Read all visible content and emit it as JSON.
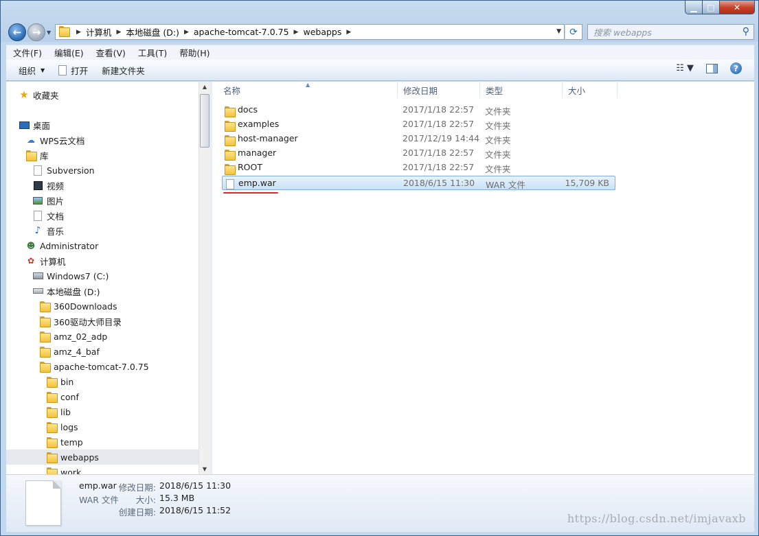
{
  "window": {
    "controls": {
      "minimize": "▁",
      "maximize": "□",
      "close": "✕"
    }
  },
  "address": {
    "crumbs": [
      "计算机",
      "本地磁盘 (D:)",
      "apache-tomcat-7.0.75",
      "webapps"
    ]
  },
  "search": {
    "placeholder": "搜索 webapps"
  },
  "menu": [
    "文件(F)",
    "编辑(E)",
    "查看(V)",
    "工具(T)",
    "帮助(H)"
  ],
  "toolbar": {
    "organize": "组织",
    "open": "打开",
    "new_folder": "新建文件夹"
  },
  "nav": {
    "items": [
      {
        "label": "收藏夹",
        "icon": "star-icon"
      },
      {
        "label": "桌面",
        "icon": "desktop-icon"
      },
      {
        "label": "WPS云文档",
        "icon": "cloud-icon"
      },
      {
        "label": "库",
        "icon": "library-icon"
      },
      {
        "label": "Subversion",
        "icon": "document-library-icon"
      },
      {
        "label": "视频",
        "icon": "video-icon"
      },
      {
        "label": "图片",
        "icon": "picture-icon"
      },
      {
        "label": "文档",
        "icon": "document-icon"
      },
      {
        "label": "音乐",
        "icon": "music-icon"
      },
      {
        "label": "Administrator",
        "icon": "user-icon"
      },
      {
        "label": "计算机",
        "icon": "computer-icon"
      },
      {
        "label": "Windows7 (C:)",
        "icon": "drive-c-icon"
      },
      {
        "label": "本地磁盘 (D:)",
        "icon": "drive-icon"
      },
      {
        "label": "360Downloads",
        "icon": "folder-icon"
      },
      {
        "label": "360驱动大师目录",
        "icon": "folder-icon"
      },
      {
        "label": "amz_02_adp",
        "icon": "folder-icon"
      },
      {
        "label": "amz_4_baf",
        "icon": "folder-icon"
      },
      {
        "label": "apache-tomcat-7.0.75",
        "icon": "folder-icon"
      },
      {
        "label": "bin",
        "icon": "folder-icon"
      },
      {
        "label": "conf",
        "icon": "folder-icon"
      },
      {
        "label": "lib",
        "icon": "folder-icon"
      },
      {
        "label": "logs",
        "icon": "folder-icon"
      },
      {
        "label": "temp",
        "icon": "folder-icon"
      },
      {
        "label": "webapps",
        "icon": "folder-icon"
      },
      {
        "label": "work",
        "icon": "folder-icon"
      }
    ]
  },
  "columns": {
    "name": "名称",
    "date": "修改日期",
    "type": "类型",
    "size": "大小"
  },
  "files": [
    {
      "name": "docs",
      "date": "2017/1/18 22:57",
      "type": "文件夹",
      "size": ""
    },
    {
      "name": "examples",
      "date": "2017/1/18 22:57",
      "type": "文件夹",
      "size": ""
    },
    {
      "name": "host-manager",
      "date": "2017/12/19 14:44",
      "type": "文件夹",
      "size": ""
    },
    {
      "name": "manager",
      "date": "2017/1/18 22:57",
      "type": "文件夹",
      "size": ""
    },
    {
      "name": "ROOT",
      "date": "2017/1/18 22:57",
      "type": "文件夹",
      "size": ""
    },
    {
      "name": "emp.war",
      "date": "2018/6/15 11:30",
      "type": "WAR 文件",
      "size": "15,709 KB"
    }
  ],
  "details": {
    "filename": "emp.war",
    "filetype": "WAR 文件",
    "modified_label": "修改日期:",
    "modified": "2018/6/15 11:30",
    "size_label": "大小:",
    "size": "15.3 MB",
    "created_label": "创建日期:",
    "created": "2018/6/15 11:52"
  },
  "watermark": "https://blog.csdn.net/imjavaxb"
}
